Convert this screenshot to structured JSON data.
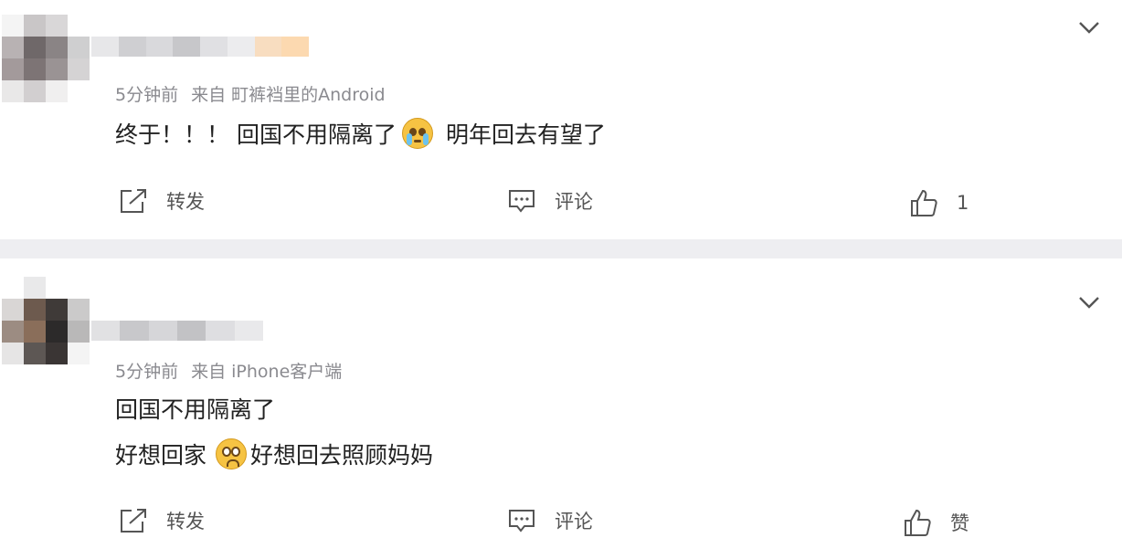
{
  "comments": [
    {
      "time": "5分钟前",
      "source": "来自 町裤裆里的Android",
      "lines": [
        {
          "before": "终于！！！ 回国不用隔离了",
          "emoji": "loudly-crying-face",
          "after": "明年回去有望了"
        }
      ],
      "actions": {
        "repost": "转发",
        "comment": "评论",
        "like": "1"
      }
    },
    {
      "time": "5分钟前",
      "source": "来自 iPhone客户端",
      "lines": [
        {
          "before": "回国不用隔离了",
          "emoji": "",
          "after": ""
        },
        {
          "before": "好想回家",
          "emoji": "pleading-face",
          "after": "好想回去照顾妈妈"
        }
      ],
      "actions": {
        "repost": "转发",
        "comment": "评论",
        "like": "赞"
      }
    }
  ],
  "colors": {
    "page_bg": "#eeeef1",
    "card_bg": "#ffffff",
    "meta_text": "#8a8a8f",
    "body_text": "#222222"
  }
}
